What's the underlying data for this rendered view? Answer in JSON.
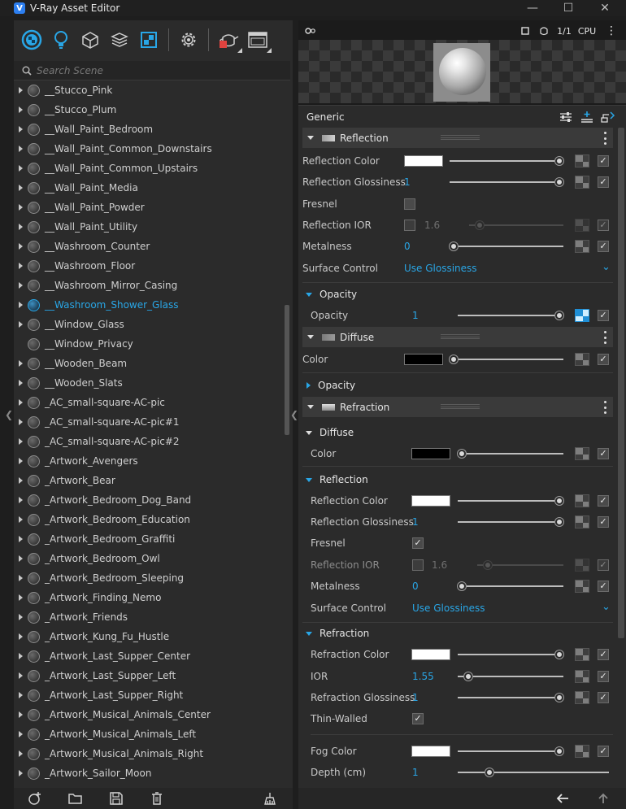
{
  "window": {
    "title": "V-Ray Asset Editor",
    "logo_letter": "V"
  },
  "search": {
    "placeholder": "Search Scene"
  },
  "tree": {
    "items": [
      {
        "label": "__Stucco_Pink",
        "arrow": true
      },
      {
        "label": "__Stucco_Plum",
        "arrow": true
      },
      {
        "label": "__Wall_Paint_Bedroom",
        "arrow": true
      },
      {
        "label": "__Wall_Paint_Common_Downstairs",
        "arrow": true
      },
      {
        "label": "__Wall_Paint_Common_Upstairs",
        "arrow": true
      },
      {
        "label": "__Wall_Paint_Media",
        "arrow": true
      },
      {
        "label": "__Wall_Paint_Powder",
        "arrow": true
      },
      {
        "label": "__Wall_Paint_Utility",
        "arrow": true
      },
      {
        "label": "__Washroom_Counter",
        "arrow": true
      },
      {
        "label": "__Washroom_Floor",
        "arrow": true
      },
      {
        "label": "__Washroom_Mirror_Casing",
        "arrow": true
      },
      {
        "label": "__Washroom_Shower_Glass",
        "arrow": true,
        "selected": true
      },
      {
        "label": "__Window_Glass",
        "arrow": true
      },
      {
        "label": "__Window_Privacy",
        "arrow": false
      },
      {
        "label": "__Wooden_Beam",
        "arrow": true
      },
      {
        "label": "__Wooden_Slats",
        "arrow": true
      },
      {
        "label": "_AC_small-square-AC-pic",
        "arrow": true
      },
      {
        "label": "_AC_small-square-AC-pic#1",
        "arrow": true
      },
      {
        "label": "_AC_small-square-AC-pic#2",
        "arrow": true
      },
      {
        "label": "_Artwork_Avengers",
        "arrow": true
      },
      {
        "label": "_Artwork_Bear",
        "arrow": true
      },
      {
        "label": "_Artwork_Bedroom_Dog_Band",
        "arrow": true
      },
      {
        "label": "_Artwork_Bedroom_Education",
        "arrow": true
      },
      {
        "label": "_Artwork_Bedroom_Graffiti",
        "arrow": true
      },
      {
        "label": "_Artwork_Bedroom_Owl",
        "arrow": true
      },
      {
        "label": "_Artwork_Bedroom_Sleeping",
        "arrow": true
      },
      {
        "label": "_Artwork_Finding_Nemo",
        "arrow": true
      },
      {
        "label": "_Artwork_Friends",
        "arrow": true
      },
      {
        "label": "_Artwork_Kung_Fu_Hustle",
        "arrow": true
      },
      {
        "label": "_Artwork_Last_Supper_Center",
        "arrow": true
      },
      {
        "label": "_Artwork_Last_Supper_Left",
        "arrow": true
      },
      {
        "label": "_Artwork_Last_Supper_Right",
        "arrow": true
      },
      {
        "label": "_Artwork_Musical_Animals_Center",
        "arrow": true
      },
      {
        "label": "_Artwork_Musical_Animals_Left",
        "arrow": true
      },
      {
        "label": "_Artwork_Musical_Animals_Right",
        "arrow": true
      },
      {
        "label": "_Artwork_Sailor_Moon",
        "arrow": true
      }
    ]
  },
  "preview": {
    "pass": "1/1",
    "engine": "CPU"
  },
  "props": {
    "header": "Generic",
    "sections": {
      "reflection": "Reflection",
      "opacity": "Opacity",
      "diffuse": "Diffuse",
      "opacity_collapsed": "Opacity",
      "refraction": "Refraction",
      "diffuse_sub": "Diffuse",
      "reflection_sub": "Reflection",
      "refraction_sub": "Refraction"
    },
    "rows": {
      "refl_color": "Reflection Color",
      "refl_gloss": "Reflection Glossiness",
      "refl_gloss_val": "1",
      "fresnel": "Fresnel",
      "refl_ior": "Reflection IOR",
      "refl_ior_val": "1.6",
      "metalness": "Metalness",
      "metalness_val": "0",
      "surface_control": "Surface Control",
      "surface_control_val": "Use Glossiness",
      "opacity": "Opacity",
      "opacity_val": "1",
      "color": "Color",
      "refr_color": "Refraction Color",
      "ior": "IOR",
      "ior_val": "1.55",
      "refr_gloss": "Refraction Glossiness",
      "refr_gloss_val": "1",
      "thin_walled": "Thin-Walled",
      "fog_color": "Fog Color",
      "depth": "Depth (cm)",
      "depth_val": "1"
    }
  },
  "colors": {
    "accent": "#29a6e6",
    "swatch_white": "#ffffff",
    "swatch_black": "#000000"
  },
  "icons": {
    "toolbar": [
      "materials-icon",
      "lights-icon",
      "geometry-icon",
      "layers-icon",
      "render-elements-icon",
      "settings-icon",
      "render-teapot-icon",
      "frame-buffer-icon"
    ],
    "footer": [
      "add-material-icon",
      "open-folder-icon",
      "save-icon",
      "delete-icon",
      "purge-icon"
    ]
  }
}
